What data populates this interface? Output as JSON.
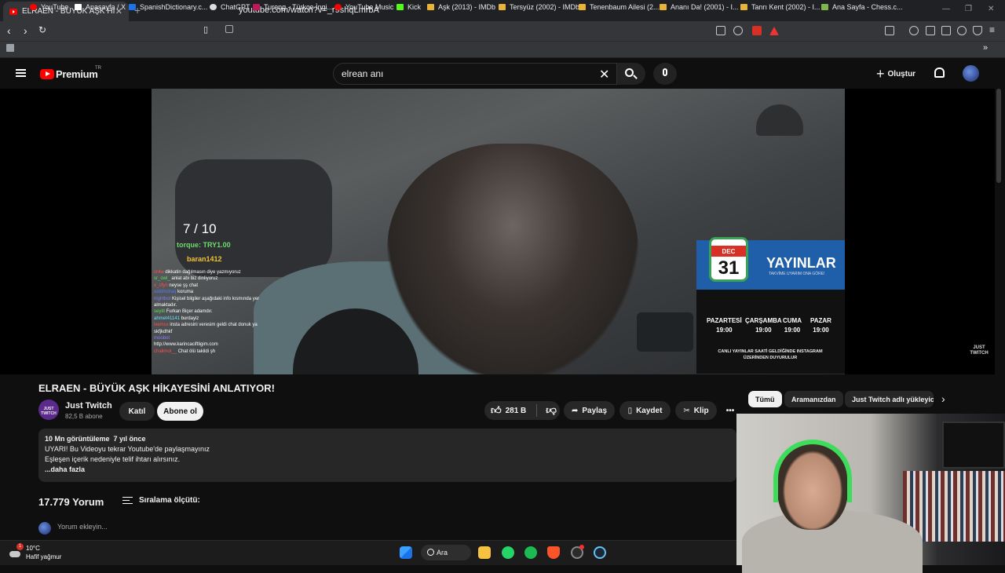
{
  "browser": {
    "tab_title": "ELRAEN - BÜYÜK AŞK HİKAYESİNİ",
    "url": "youtube.com/watch?v=_r9shqLmrbA",
    "bookmarks": [
      {
        "label": "YouTube",
        "icon": "youtube-icon"
      },
      {
        "label": "Anasayfa / X",
        "icon": "x-icon"
      },
      {
        "label": "SpanishDictionary.c...",
        "icon": "spanishdict-icon"
      },
      {
        "label": "ChatGPT",
        "icon": "chatgpt-icon"
      },
      {
        "label": "Tureng - Türkçe İngi...",
        "icon": "tureng-icon"
      },
      {
        "label": "YouTube Music",
        "icon": "ytmusic-icon"
      },
      {
        "label": "Kick",
        "icon": "kick-icon"
      },
      {
        "label": "Aşk (2013) - IMDb",
        "icon": "folder-icon"
      },
      {
        "label": "Tersyüz (2002) - IMDb",
        "icon": "folder-icon"
      },
      {
        "label": "Tenenbaum Ailesi (2...",
        "icon": "folder-icon"
      },
      {
        "label": "Ananı Da! (2001) - I...",
        "icon": "folder-icon"
      },
      {
        "label": "Tanrı Kent (2002) - I...",
        "icon": "folder-icon"
      },
      {
        "label": "Ana Sayfa - Chess.c...",
        "icon": "chess-icon"
      }
    ]
  },
  "yt": {
    "logo": "Premium",
    "region": "TR",
    "search_value": "elrean anı",
    "create_label": "Oluştur"
  },
  "video_overlay": {
    "rank": "7 / 10",
    "torque": "torque: TRY1.00",
    "donor": "baran1412",
    "chat": [
      {
        "user": "cr4w",
        "text": "dikkatin dağılmasın diye yazmıyoruz",
        "color": "#ff4d4d"
      },
      {
        "user": "sr_owl_",
        "text": "anlat abi biz dinliyoruz",
        "color": "#5ee05e"
      },
      {
        "user": "x_ofyn",
        "text": "neyse şş chat",
        "color": "#ff4d4d"
      },
      {
        "user": "xatdmdraq",
        "text": "koruma",
        "color": "#4d7dff"
      },
      {
        "user": "nightbot",
        "text": "Kişisel bilgiler aşağıdaki info kısmında yer almaktadır.",
        "color": "#7e7ef5"
      },
      {
        "user": "seyitt",
        "text": "Furkan Biçer adamdır.",
        "color": "#5ee05e"
      },
      {
        "user": "ahmet41141",
        "text": "burdayiz",
        "color": "#6be0ff"
      },
      {
        "user": "lxemsx",
        "text": "insta adresini veresim geldi chat donuk ya skfjkdhkf",
        "color": "#ff4d4d"
      },
      {
        "user": "moobot",
        "text": "http://www.karincaciftligim.com",
        "color": "#8d7ef5"
      },
      {
        "user": "chalimot__",
        "text": "Chat ölü takildi şh",
        "color": "#ff4d4d"
      }
    ],
    "schedule": {
      "month": "DEC",
      "day": "31",
      "title": "YAYINLAR",
      "tagline": "TAKVİME UYARIM ONA GÖRE!",
      "days": [
        {
          "name": "PAZARTESİ",
          "time": "19:00"
        },
        {
          "name": "ÇARŞAMBA",
          "time": "19:00"
        },
        {
          "name": "CUMA",
          "time": "19:00"
        },
        {
          "name": "PAZAR",
          "time": "19:00"
        }
      ],
      "note": "CANLI YAYINLAR SAATİ GELDİĞİNDE INSTAGRAM ÜZERİNDEN DUYURULUR"
    },
    "watermark": "JUST TWITCH"
  },
  "video": {
    "title": "ELRAEN - BÜYÜK AŞK HİKAYESİNİ ANLATIYOR!",
    "channel": "Just Twitch",
    "channel_avatar_text": "JUST TWITCH",
    "subscribers": "82,5 B abone",
    "join_label": "Katıl",
    "subscribe_label": "Abone ol",
    "likes": "281 B",
    "share_label": "Paylaş",
    "save_label": "Kaydet",
    "clip_label": "Klip",
    "more_label": "•••"
  },
  "chips": [
    "Tümü",
    "Aramanızdan",
    "Just Twitch adlı yükleyiciden"
  ],
  "description": {
    "views": "10 Mn görüntüleme",
    "age": "7 yıl önce",
    "line1": "UYARI! Bu Videoyu tekrar Youtube'de paylaşmayınız",
    "line2": "Eşleşen içerik nedeniyle telif ihtarı alırsınız.",
    "more": "...daha fazla"
  },
  "comments": {
    "count": "17.779 Yorum",
    "sort_label": "Sıralama ölçütü:",
    "add_placeholder": "Yorum ekleyin..."
  },
  "taskbar": {
    "weather_badge": "1",
    "temp": "10°C",
    "condition": "Hafif yağmur",
    "search_label": "Ara"
  },
  "colors": {
    "yt_red": "#ff0000",
    "bg": "#0f0f0f",
    "pill": "#272727",
    "schedule_blue": "#1f5ea8",
    "headset_green": "#3ddc5a"
  }
}
